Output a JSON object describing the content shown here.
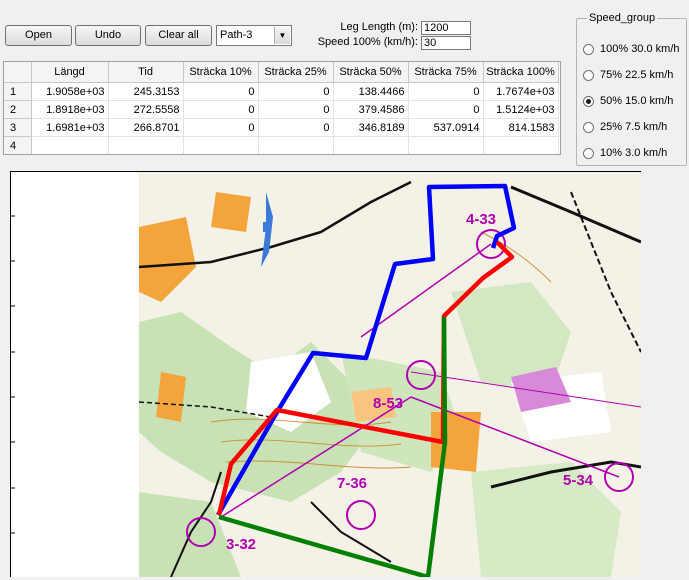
{
  "toolbar": {
    "open_label": "Open",
    "undo_label": "Undo",
    "clear_label": "Clear all",
    "path_select_value": "Path-3"
  },
  "params": {
    "leg_length_label": "Leg Length (m):",
    "leg_length_value": "1200",
    "speed_label": "Speed 100% (km/h):",
    "speed_value": "30"
  },
  "table": {
    "headers": [
      "Längd",
      "Tid",
      "Sträcka 10%",
      "Sträcka 25%",
      "Sträcka 50%",
      "Sträcka 75%",
      "Sträcka 100%"
    ],
    "rows": [
      {
        "id": "1",
        "cells": [
          "1.9058e+03",
          "245.3153",
          "0",
          "0",
          "138.4466",
          "0",
          "1.7674e+03"
        ]
      },
      {
        "id": "2",
        "cells": [
          "1.8918e+03",
          "272.5558",
          "0",
          "0",
          "379.4586",
          "0",
          "1.5124e+03"
        ]
      },
      {
        "id": "3",
        "cells": [
          "1.6981e+03",
          "266.8701",
          "0",
          "0",
          "346.8189",
          "537.0914",
          "814.1583"
        ]
      },
      {
        "id": "4",
        "cells": [
          "",
          "",
          "",
          "",
          "",
          "",
          ""
        ]
      }
    ]
  },
  "speed_group": {
    "title": "Speed_group",
    "options": [
      {
        "label": "100% 30.0 km/h",
        "selected": false
      },
      {
        "label": "75% 22.5 km/h",
        "selected": false
      },
      {
        "label": "50% 15.0 km/h",
        "selected": true
      },
      {
        "label": "25% 7.5 km/h",
        "selected": false
      },
      {
        "label": "10% 3.0 km/h",
        "selected": false
      }
    ]
  },
  "map": {
    "control_labels": [
      "4-33",
      "8-53",
      "7-36",
      "5-34",
      "3-32"
    ],
    "colors": {
      "path_blue": "#0000ff",
      "path_red": "#ff0000",
      "path_green": "#008000",
      "control_magenta": "#b000b0"
    }
  }
}
